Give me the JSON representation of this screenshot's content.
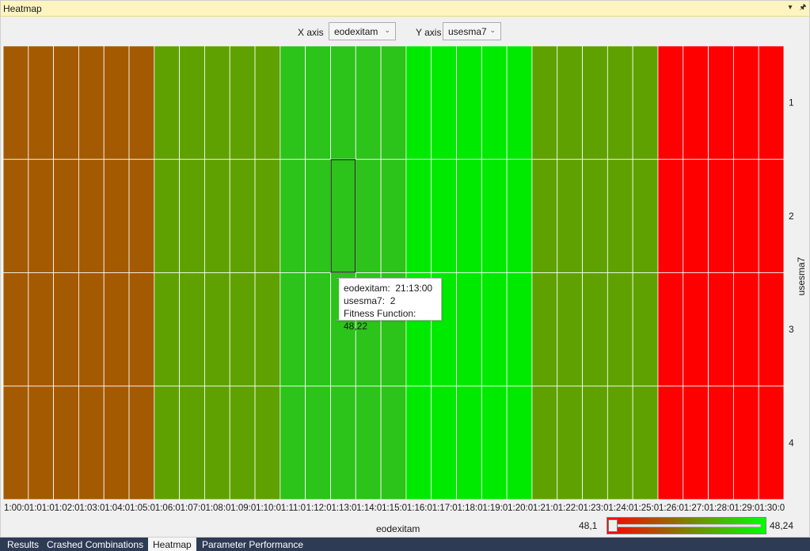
{
  "panel": {
    "title": "Heatmap",
    "dropdown_glyph": "▾",
    "pin_glyph": "🖈"
  },
  "controls": {
    "x_label": "X axis",
    "x_value": "eodexitam",
    "y_label": "Y axis",
    "y_value": "usesma7",
    "caret": "⌄"
  },
  "chart_data": {
    "type": "heatmap",
    "xlabel": "eodexitam",
    "ylabel": "usesma7",
    "x_tick_labels": [
      "1:00:0",
      "1:01:0",
      "1:02:0",
      "1:03:0",
      "1:04:0",
      "1:05:0",
      "1:06:0",
      "1:07:0",
      "1:08:0",
      "1:09:0",
      "1:10:0",
      "1:11:0",
      "1:12:0",
      "1:13:0",
      "1:14:0",
      "1:15:0",
      "1:16:0",
      "1:17:0",
      "1:18:0",
      "1:19:0",
      "1:20:0",
      "1:21:0",
      "1:22:0",
      "1:23:0",
      "1:24:0",
      "1:25:0",
      "1:26:0",
      "1:27:0",
      "1:28:0",
      "1:29:0",
      "1:30:0"
    ],
    "y_categories": [
      "1",
      "2",
      "3",
      "4"
    ],
    "value_range": [
      48.1,
      48.24
    ],
    "column_colors": [
      "#a45a00",
      "#a45a00",
      "#a45a00",
      "#a45a00",
      "#a45a00",
      "#a45a00",
      "#5fa200",
      "#5fa200",
      "#5fa200",
      "#5fa200",
      "#5fa200",
      "#2cc31a",
      "#2cc31a",
      "#2cc31a",
      "#2cc31a",
      "#2cc31a",
      "#00ea00",
      "#00ea00",
      "#00ea00",
      "#00ea00",
      "#00ea00",
      "#5fa200",
      "#5fa200",
      "#5fa200",
      "#5fa200",
      "#5fa200",
      "#ff0000",
      "#ff0000",
      "#ff0000",
      "#ff0000",
      "#ff0000"
    ],
    "highlight_cell": {
      "column": 13,
      "row": 1
    }
  },
  "tooltip": {
    "x_label": "eodexitam:",
    "x_value": "21:13:00",
    "y_label": "usesma7:",
    "y_value": "2",
    "f_label": "Fitness Function:",
    "f_value": "48,22"
  },
  "legend": {
    "min": "48,1",
    "max": "48,24",
    "slider_position": 0
  },
  "bottom_tabs": [
    {
      "label": "Results",
      "active": false
    },
    {
      "label": "Crashed Combinations",
      "active": false
    },
    {
      "label": "Heatmap",
      "active": true
    },
    {
      "label": "Parameter Performance",
      "active": false
    }
  ]
}
